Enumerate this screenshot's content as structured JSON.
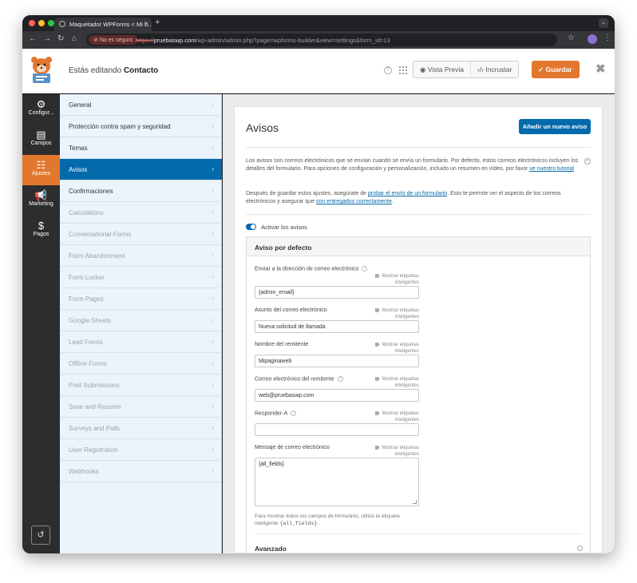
{
  "browser": {
    "tab_title": "Maquetador WPForms < Mi b...",
    "tab_close": "×",
    "new_tab": "+",
    "back": "←",
    "forward": "→",
    "reload": "↻",
    "home": "⌂",
    "security_chip": "No es seguro",
    "url_scheme": "https://",
    "url_host": "pruebaswp.com",
    "url_path": "/wp-admin/admin.php?page=wpforms-builder&view=settings&form_id=13",
    "star": "☆",
    "menu": "⋮",
    "tab_menu": "⌄"
  },
  "header": {
    "editing_prefix": "Estás editando",
    "form_name": "Contacto",
    "help": "?",
    "preview_label": "Vista Previa",
    "embed_label": "Incrustar",
    "save_label": "Guardar",
    "close": "✖"
  },
  "sidebar": {
    "items": [
      {
        "icon": "⚙",
        "label": "Configur..."
      },
      {
        "icon": "▤",
        "label": "Campos"
      },
      {
        "icon": "☷",
        "label": "Ajustes"
      },
      {
        "icon": "📢",
        "label": "Marketing"
      },
      {
        "icon": "$",
        "label": "Pagos"
      }
    ],
    "undo": "↺"
  },
  "settings_menu": [
    "General",
    "Protección contra spam y seguridad",
    "Temas",
    "Avisos",
    "Confirmaciones",
    "Calculations",
    "Conversational Forms",
    "Form Abandonment",
    "Form Locker",
    "Form Pages",
    "Google Sheets",
    "Lead Forms",
    "Offline Forms",
    "Post Submissions",
    "Save and Resume",
    "Surveys and Polls",
    "User Registration",
    "Webhooks"
  ],
  "chevron": "›",
  "main": {
    "title": "Avisos",
    "add_button": "Añadir un nuevo aviso",
    "intro_1": "Los avisos son correos electrónicos que se envían cuando se envía un formulario. Por defecto, estos correos electrónicos incluyen los detalles del formulario. Para opciones de configuración y personalización, incluido un resumen en vídeo, por favor",
    "intro_1_link": "ve nuestro tutorial",
    "intro_2_a": "Después de guardar estos ajustes, asegúrate de",
    "intro_2_link1": "probar el envío de un formulario",
    "intro_2_b": ". Esto te permite ver el aspecto de los correos electrónicos y asegurar que",
    "intro_2_link2": "son entregados correctamente",
    "intro_2_end": ".",
    "dismiss": "×",
    "toggle_label": "Activar los avisos",
    "notification_title": "Aviso por defecto",
    "smart_tags": "Mostrar etiquetas inteligentes",
    "q": "?",
    "fields": {
      "send_to_label": "Enviar a la dirección de correo electrónico",
      "send_to_value": "{admin_email}",
      "subject_label": "Asunto del correo electrónico",
      "subject_value": "Nueva solicitud de llamada",
      "from_name_label": "Nombre del remitente",
      "from_name_value": "Mipaginaweb",
      "from_email_label": "Correo electrónico del remitente",
      "from_email_value": "web@pruebaswp.com",
      "reply_to_label": "Responder-A",
      "reply_to_value": "",
      "message_label": "Mensaje de correo electrónico",
      "message_value": "{all_fields}"
    },
    "hint_a": "Para mostrar todos los campos de formulario, utiliza la etiqueta inteligente",
    "hint_code": "{all_fields}",
    "hint_end": ".",
    "advanced": "Avanzado"
  }
}
